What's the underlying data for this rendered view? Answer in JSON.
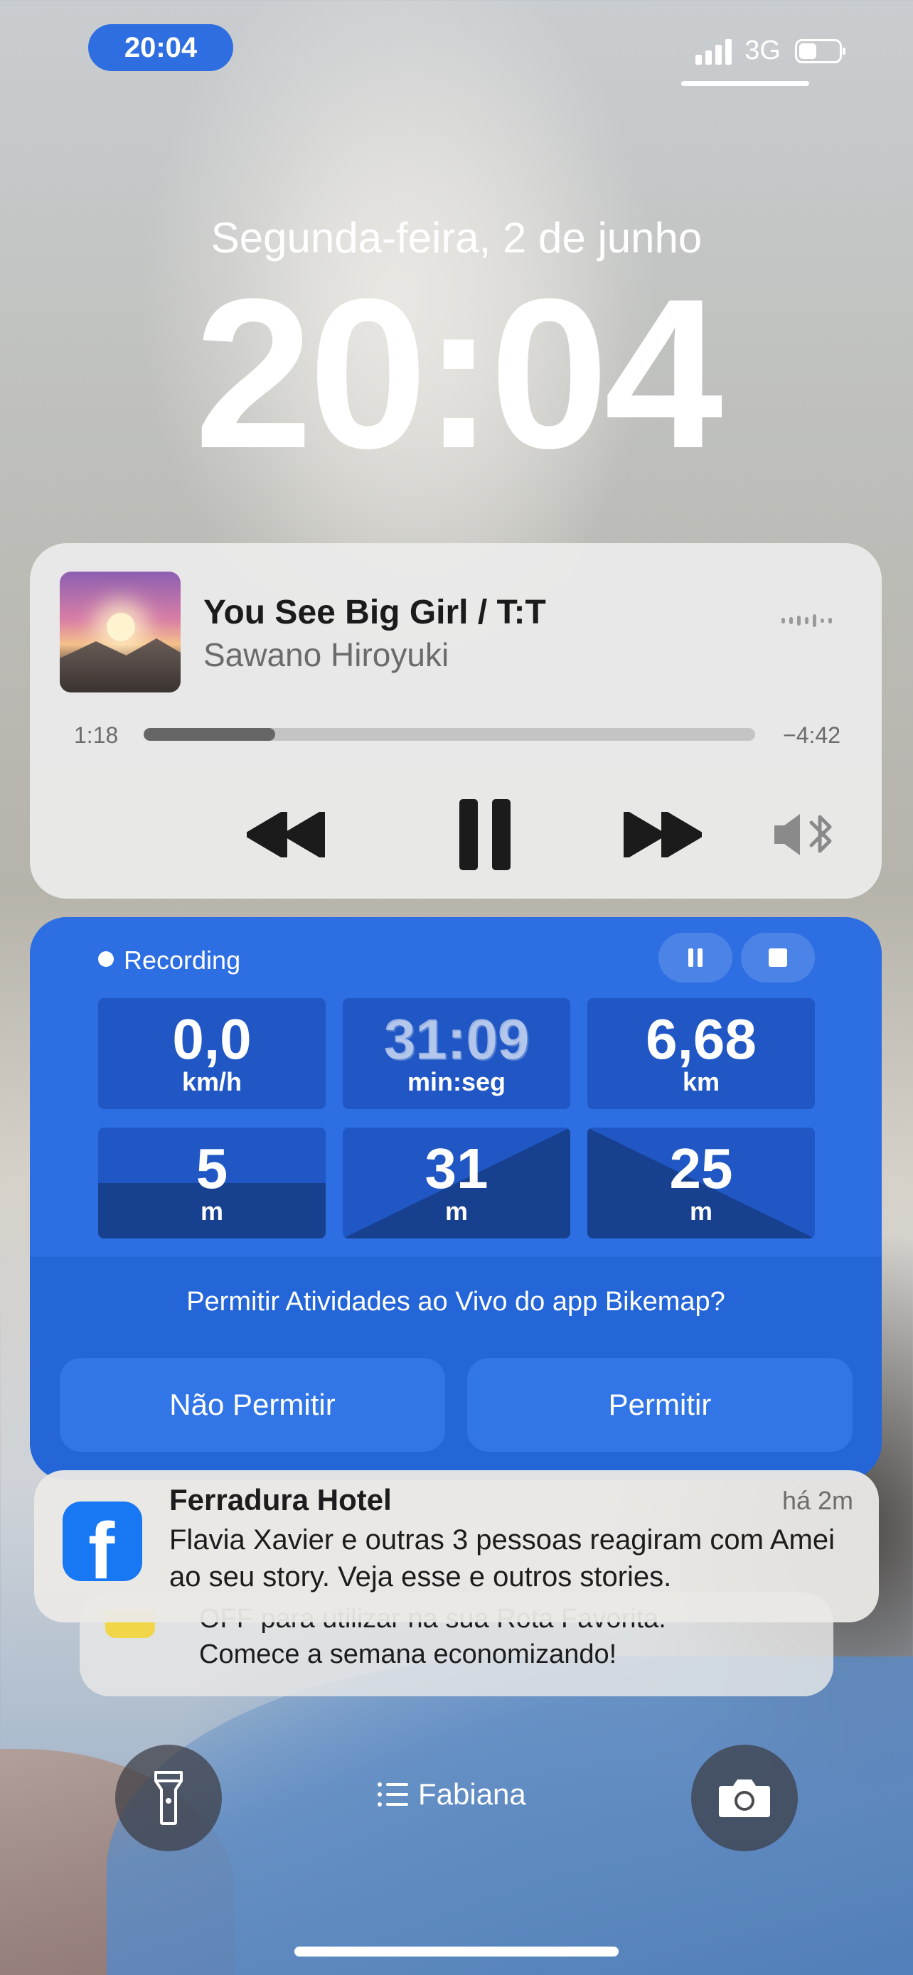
{
  "status_bar": {
    "time": "20:04",
    "network": "3G",
    "signal_bars": 4,
    "battery_level": 0.45
  },
  "lock_screen": {
    "date": "Segunda-feira, 2 de junho",
    "time": "20:04",
    "focus_mode": "Fabiana"
  },
  "now_playing": {
    "title": "You See Big Girl / T:T",
    "artist": "Sawano Hiroyuki",
    "elapsed": "1:18",
    "remaining": "−4:42",
    "progress": 0.215,
    "icons": {
      "rewind": "rewind-icon",
      "pause": "pause-icon",
      "forward": "fast-forward-icon",
      "output": "speaker-bluetooth-icon"
    }
  },
  "live_activity": {
    "status": "Recording",
    "speed": {
      "value": "0,0",
      "unit": "km/h"
    },
    "duration": {
      "value": "31:09",
      "unit": "min:seg"
    },
    "distance": {
      "value": "6,68",
      "unit": "km"
    },
    "elevation_current": {
      "value": "5",
      "unit": "m"
    },
    "elevation_gain": {
      "value": "31",
      "unit": "m"
    },
    "elevation_loss": {
      "value": "25",
      "unit": "m"
    },
    "prompt": "Permitir Atividades ao Vivo do app Bikemap?",
    "deny_label": "Não Permitir",
    "allow_label": "Permitir",
    "colors": {
      "primary": "#2d6ee3",
      "tile": "#2057c4",
      "tile_dark": "#17418f"
    }
  },
  "notifications": [
    {
      "app_icon": "facebook-icon",
      "title": "Ferradura Hotel",
      "time": "há 2m",
      "body": "Flavia Xavier e outras 3 pessoas reagiram com Amei ao seu story. Veja esse e outros stories."
    },
    {
      "line1": "OFF para utilizar na sua Rota Favorita.",
      "line2": "Comece a semana economizando!"
    }
  ]
}
